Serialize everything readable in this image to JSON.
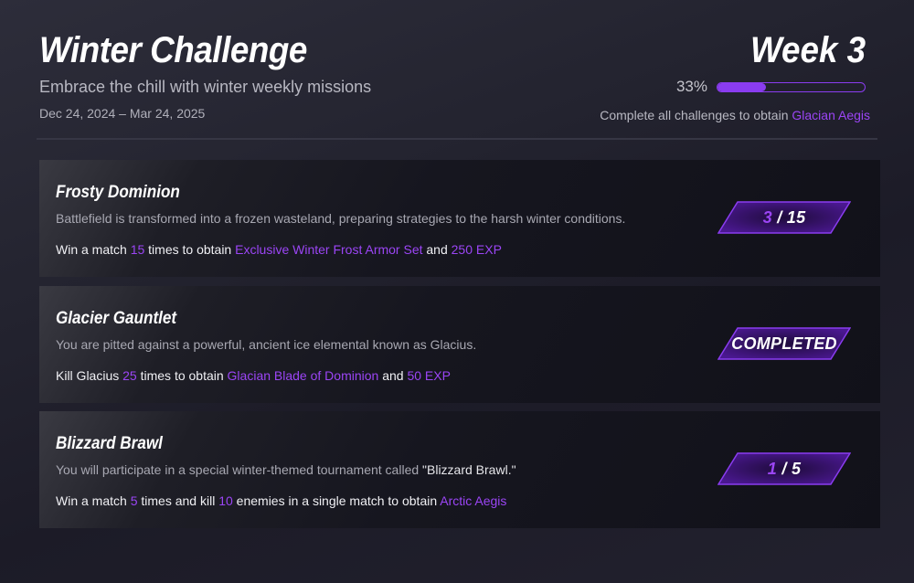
{
  "header": {
    "title": "Winter Challenge",
    "subtitle": "Embrace the chill with winter weekly missions",
    "date_range": "Dec 24, 2024 – Mar 24, 2025",
    "week_label": "Week 3",
    "progress_text": "33%",
    "progress_fraction": 0.33,
    "reward_prefix": "Complete all challenges to obtain ",
    "reward_name": "Glacian Aegis"
  },
  "colors": {
    "accent": "#9b45f5",
    "progress_bar": "#8a3cf0",
    "badge_fill": "#3a1275",
    "badge_border": "#8a3cf0"
  },
  "challenges": [
    {
      "title": "Frosty Dominion",
      "description": "Battlefield is transformed into a frozen wasteland, preparing strategies to the harsh winter conditions.",
      "task": {
        "t1": "Win a match ",
        "n1": "15",
        "t2": " times to obtain ",
        "r1": "Exclusive Winter Frost Armor Set",
        "t3": " and ",
        "r2": "250 EXP"
      },
      "status": {
        "current": "3",
        "separator": " / ",
        "total": "15"
      }
    },
    {
      "title": "Glacier Gauntlet",
      "description": "You are pitted against a powerful, ancient ice elemental known as Glacius.",
      "task": {
        "t1": "Kill Glacius ",
        "n1": "25",
        "t2": " times to obtain ",
        "r1": "Glacian Blade of Dominion",
        "t3": " and ",
        "r2": "50 EXP"
      },
      "status": {
        "label": "COMPLETED"
      }
    },
    {
      "title": "Blizzard Brawl",
      "description_prefix": "You will participate in a special winter-themed tournament called ",
      "description_highlight": "\"Blizzard Brawl.\"",
      "task": {
        "t1": "Win a match ",
        "n1": "5",
        "t2": " times and kill ",
        "n2": "10",
        "t3": " enemies in a single match to obtain ",
        "r1": "Arctic Aegis"
      },
      "status": {
        "current": "1",
        "separator": " / ",
        "total": "5"
      }
    }
  ]
}
